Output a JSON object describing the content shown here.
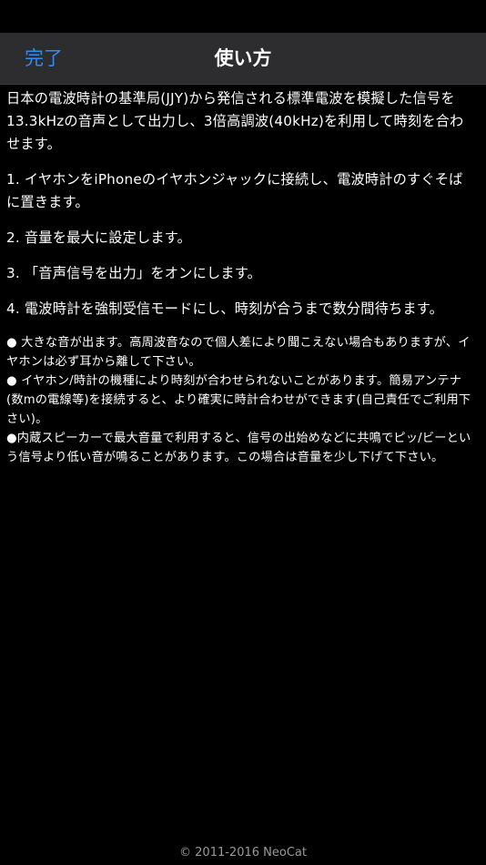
{
  "nav": {
    "done_label": "完了",
    "title": "使い方"
  },
  "content": {
    "paragraphs": [
      "日本の電波時計の基準局(JJY)から発信される標準電波を模擬した信号を13.3kHzの音声として出力し、3倍高調波(40kHz)を利用して時刻を合わせます。",
      "1. イヤホンをiPhoneのイヤホンジャックに接続し、電波時計のすぐそばに置きます。",
      "2. 音量を最大に設定します。",
      "3. 「音声信号を出力」をオンにします。",
      "4. 電波時計を強制受信モードにし、時刻が合うまで数分間待ちます。"
    ],
    "notes": [
      "● 大きな音が出ます。高周波音なので個人差により聞こえない場合もありますが、イヤホンは必ず耳から離して下さい。",
      "● イヤホン/時計の機種により時刻が合わせられないことがあります。簡易アンテナ(数mの電線等)を接続すると、より確実に時計合わせができます(自己責任でご利用下さい)。",
      "●内蔵スピーカーで最大音量で利用すると、信号の出始めなどに共鳴でピッ/ビーという信号より低い音が鳴ることがあります。この場合は音量を少し下げて下さい。"
    ]
  },
  "footer": {
    "copyright": "© 2011-2016 NeoCat"
  },
  "colors": {
    "background": "#000000",
    "nav_background": "#2d2d2f",
    "accent": "#2f8cf5",
    "text": "#ffffff",
    "footer_text": "#9a9a9a"
  }
}
